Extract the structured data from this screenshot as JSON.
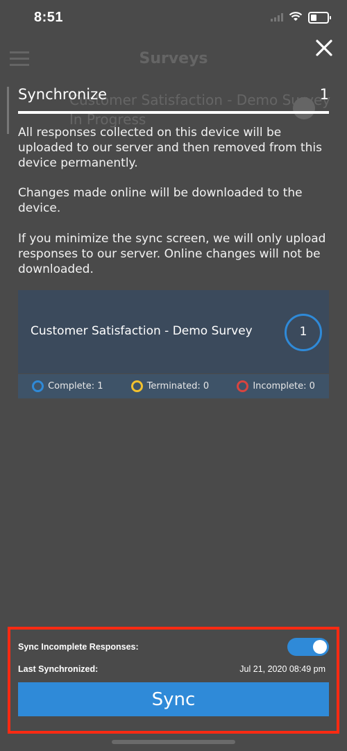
{
  "status_bar": {
    "time": "8:51"
  },
  "background_app": {
    "title": "Surveys",
    "row_title": "Customer Satisfaction - Demo Survey",
    "row_subtitle": "In Progress"
  },
  "header": {
    "title": "Synchronize",
    "count": "1"
  },
  "description": [
    "All responses collected on this device will be uploaded to our server and then removed from this device permanently.",
    "Changes made online will be downloaded to the device.",
    "If you minimize the sync screen, we will only upload responses to our server. Online changes will not be downloaded."
  ],
  "survey_card": {
    "title": "Customer Satisfaction - Demo Survey",
    "count": "1",
    "legend": [
      {
        "label": "Complete: 1",
        "color": "#2f8ad8"
      },
      {
        "label": "Terminated: 0",
        "color": "#f2c12e"
      },
      {
        "label": "Incomplete: 0",
        "color": "#d9443f"
      }
    ]
  },
  "bottom_panel": {
    "sync_incomplete_label": "Sync Incomplete Responses:",
    "sync_incomplete_enabled": true,
    "last_synchronized_label": "Last Synchronized:",
    "last_synchronized_value": "Jul 21, 2020 08:49 pm",
    "sync_button_label": "Sync"
  },
  "colors": {
    "accent": "#2f8ad8",
    "highlight_border": "#ff2a12",
    "background": "#4a4a4a",
    "card": "#3b4a5c"
  }
}
